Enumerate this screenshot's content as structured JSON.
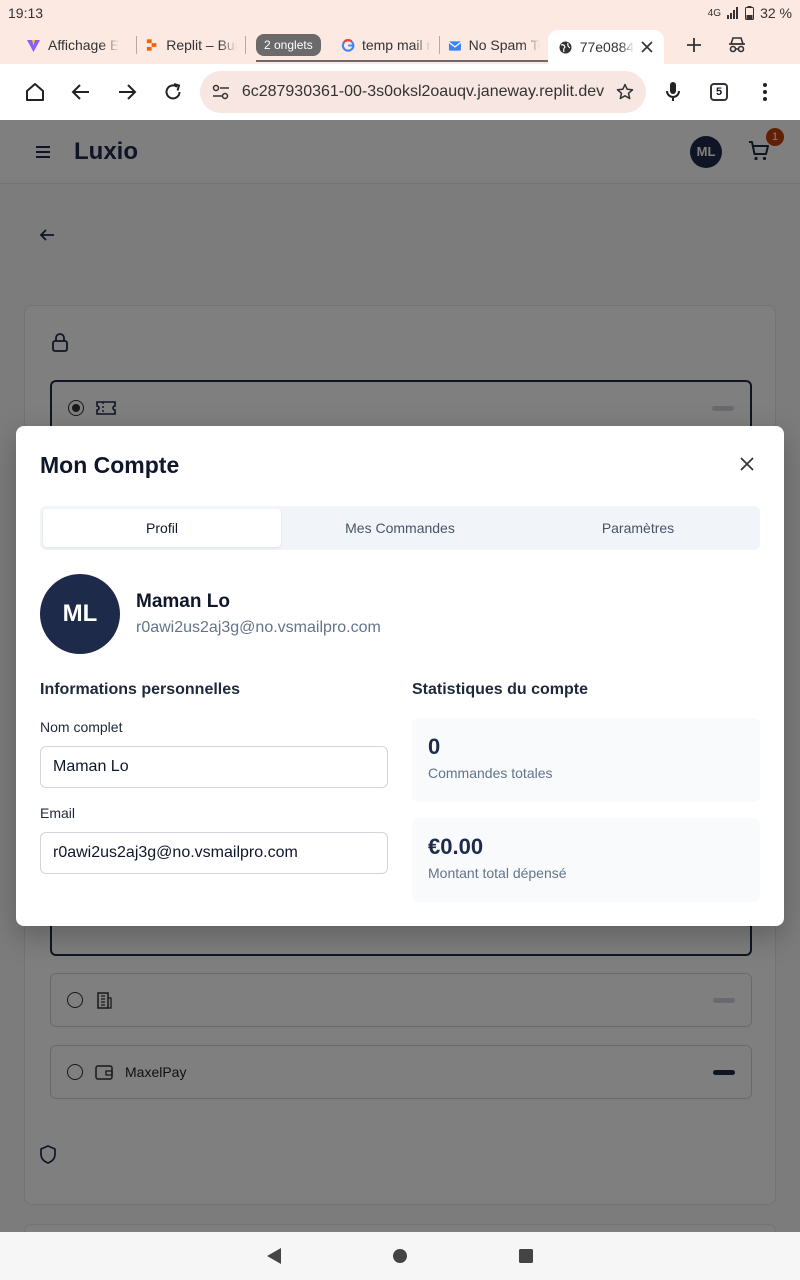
{
  "statusbar": {
    "time": "19:13",
    "network": "4G",
    "battery": "32 %"
  },
  "tabs": [
    {
      "label": "Affichage E",
      "icon": "vite-icon",
      "color": "#8b5cf6"
    },
    {
      "label": "Replit – Buil",
      "icon": "replit-icon",
      "color": "#f26207"
    },
    {
      "label": "temp mail n",
      "icon": "google-icon",
      "color": "#4285f4"
    },
    {
      "label": "No Spam To",
      "icon": "mail-icon",
      "color": "#3b82f6"
    },
    {
      "label": "77e0884",
      "icon": "globe-icon",
      "color": "#333333"
    }
  ],
  "tab_group_label": "2 onglets",
  "browser": {
    "url": "6c287930361-00-3s0oksl2oauqv.janeway.replit.dev",
    "tab_count": "5"
  },
  "app": {
    "brand": "Luxio",
    "avatar_initials": "ML",
    "cart_count": "1"
  },
  "payment": {
    "option_maxelpay": "MaxelPay"
  },
  "modal": {
    "title": "Mon Compte",
    "tabs": [
      "Profil",
      "Mes Commandes",
      "Paramètres"
    ],
    "active_tab": "Profil",
    "user": {
      "initials": "ML",
      "name": "Maman Lo",
      "email": "r0awi2us2aj3g@no.vsmailpro.com"
    },
    "personal_info": {
      "title": "Informations personnelles",
      "name_label": "Nom complet",
      "name_value": "Maman Lo",
      "email_label": "Email",
      "email_value": "r0awi2us2aj3g@no.vsmailpro.com"
    },
    "stats": {
      "title": "Statistiques du compte",
      "orders_value": "0",
      "orders_label": "Commandes totales",
      "spent_value": "€0.00",
      "spent_label": "Montant total dépensé"
    }
  },
  "colors": {
    "brand_navy": "#1e2a4a",
    "badge": "#c2410c",
    "chrome_bg": "#fbe9e2"
  }
}
